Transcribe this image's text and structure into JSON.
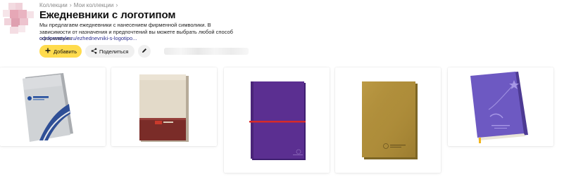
{
  "breadcrumb": {
    "root": "Коллекции",
    "current": "Мои коллекции"
  },
  "header": {
    "title": "Ежедневники с логотипом",
    "description": "Мы предлагаем ежедневники с нанесением фирменной символики. В зависимости от назначения и предпочтений вы можете выбрать любой способ оформления.",
    "link": "conformstyle.ru/ezhednevniki-s-logotipo..."
  },
  "toolbar": {
    "add_label": "Добавить",
    "share_label": "Поделиться"
  },
  "cards": [
    {
      "icon": "grey-diary-image"
    },
    {
      "icon": "beige-red-diary-image"
    },
    {
      "icon": "purple-diary-elastic-image"
    },
    {
      "icon": "gold-diary-image"
    },
    {
      "icon": "lilac-embossed-diary-image"
    }
  ],
  "colors": {
    "accent_button": "#ffdb4d",
    "link": "#2b2d8e",
    "secondary_button": "#f0f0f0"
  }
}
